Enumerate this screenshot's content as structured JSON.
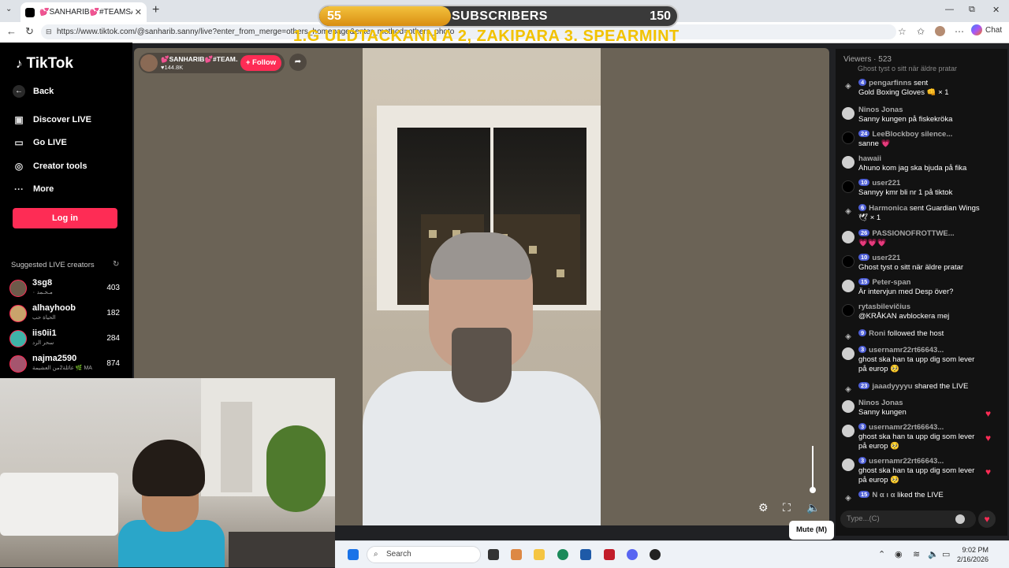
{
  "browser": {
    "tab_title": "💕SANHARIB💕#TEAMSANHARIB",
    "tab_close": "✕",
    "new_tab": "+",
    "url": "https://www.tiktok.com/@sanharib.sanny/live?enter_from_merge=others_homepage&enter_method=others_photo",
    "chat_label": "Chat"
  },
  "overlay": {
    "subs_current": "55",
    "subs_label": "SUBSCRIBERS",
    "subs_goal": "150",
    "subs_progress": 0.367,
    "ticker": "1.G ULDTACKANN A 2, ZAKIPARA  3. SPEARMINT"
  },
  "sidebar": {
    "logo": "TikTok",
    "back": "Back",
    "items": [
      {
        "label": "Discover LIVE",
        "icon": "calendar-live-icon"
      },
      {
        "label": "Go LIVE",
        "icon": "camera-icon"
      },
      {
        "label": "Creator tools",
        "icon": "lightbulb-icon"
      },
      {
        "label": "More",
        "icon": "more-dots-icon"
      }
    ],
    "login": "Log in",
    "suggested_title": "Suggested LIVE creators",
    "creators": [
      {
        "name": "3sg8",
        "sub": "مـحـمد ٠",
        "count": "403"
      },
      {
        "name": "alhayhoob",
        "sub": "الحياة حب",
        "count": "182"
      },
      {
        "name": "iis0ii1",
        "sub": "سحر الرد",
        "count": "284"
      },
      {
        "name": "najma2590",
        "sub": "عائلة2من العشيمة 🌿 MA",
        "count": "874"
      }
    ]
  },
  "stream": {
    "host_name": "💕SANHARIB💕#TEAM...",
    "host_likes": "♥144.8K",
    "follow": "+ Follow",
    "tooltip": "Mute (M)"
  },
  "chat": {
    "viewers_label": "Viewers",
    "viewers_count": "· 523",
    "cut_top": "Ghost tyst o sitt när äldre pratar",
    "messages": [
      {
        "lvl": "4",
        "user": "pengarfinns",
        "extra": " sent",
        "text": "Gold Boxing Gloves 👊 × 1",
        "av": "icon"
      },
      {
        "lvl": "",
        "user": "Ninos Jonas",
        "extra": "",
        "text": "Sanny kungen på fiskekröka",
        "av": "light"
      },
      {
        "lvl": "24",
        "user": "LeeBlockboy silence...",
        "extra": "",
        "text": "sanne 💗",
        "av": "dark"
      },
      {
        "lvl": "",
        "user": "hawaii",
        "extra": "",
        "text": "Ahuno kom jag ska bjuda på fika",
        "av": "light"
      },
      {
        "lvl": "10",
        "user": "user221",
        "extra": "",
        "text": "Sannyy kmr bli nr 1 på tiktok",
        "av": "dark"
      },
      {
        "lvl": "6",
        "user": "Harmonica",
        "extra": " sent Guardian Wings",
        "text": "🕊 × 1",
        "av": "icon"
      },
      {
        "lvl": "26",
        "user": "PASSIONOFROTTWE...",
        "extra": "",
        "text": "💗💗💗",
        "av": "light"
      },
      {
        "lvl": "10",
        "user": "user221",
        "extra": "",
        "text": "Ghost tyst o sitt när äldre pratar",
        "av": "dark"
      },
      {
        "lvl": "15",
        "user": "Peter-span",
        "extra": "",
        "text": "Är intervjun med Desp över?",
        "av": "light"
      },
      {
        "lvl": "",
        "user": "rytasbilevičius",
        "extra": "",
        "text": "@KRÅKAN avblockera mej",
        "av": "dark"
      },
      {
        "lvl": "9",
        "user": "Roni",
        "extra": " followed the host",
        "text": "",
        "av": "icon"
      },
      {
        "lvl": "3",
        "user": "usernamr22rt66643...",
        "extra": "",
        "text": "ghost ska han ta upp dig som lever på europ 🥺",
        "av": "light"
      },
      {
        "lvl": "23",
        "user": "jaaadyyyyu",
        "extra": " shared the LIVE",
        "text": "",
        "av": "icon"
      },
      {
        "lvl": "",
        "user": "Ninos Jonas",
        "extra": "",
        "text": "Sanny kungen",
        "av": "light"
      },
      {
        "lvl": "3",
        "user": "usernamr22rt66643...",
        "extra": "",
        "text": "ghost ska han ta upp dig som lever på europ 🥺",
        "av": "light"
      },
      {
        "lvl": "3",
        "user": "usernamr22rt66643...",
        "extra": "",
        "text": "ghost ska han ta upp dig som lever på europ 🥺",
        "av": "light"
      },
      {
        "lvl": "15",
        "user": "Ν α ι α",
        "extra": " liked the LIVE",
        "text": "",
        "av": "icon"
      }
    ],
    "input_placeholder": "Type...(C)"
  },
  "taskbar": {
    "search": "Search",
    "time": "9:02 PM",
    "date": "2/16/2026"
  }
}
